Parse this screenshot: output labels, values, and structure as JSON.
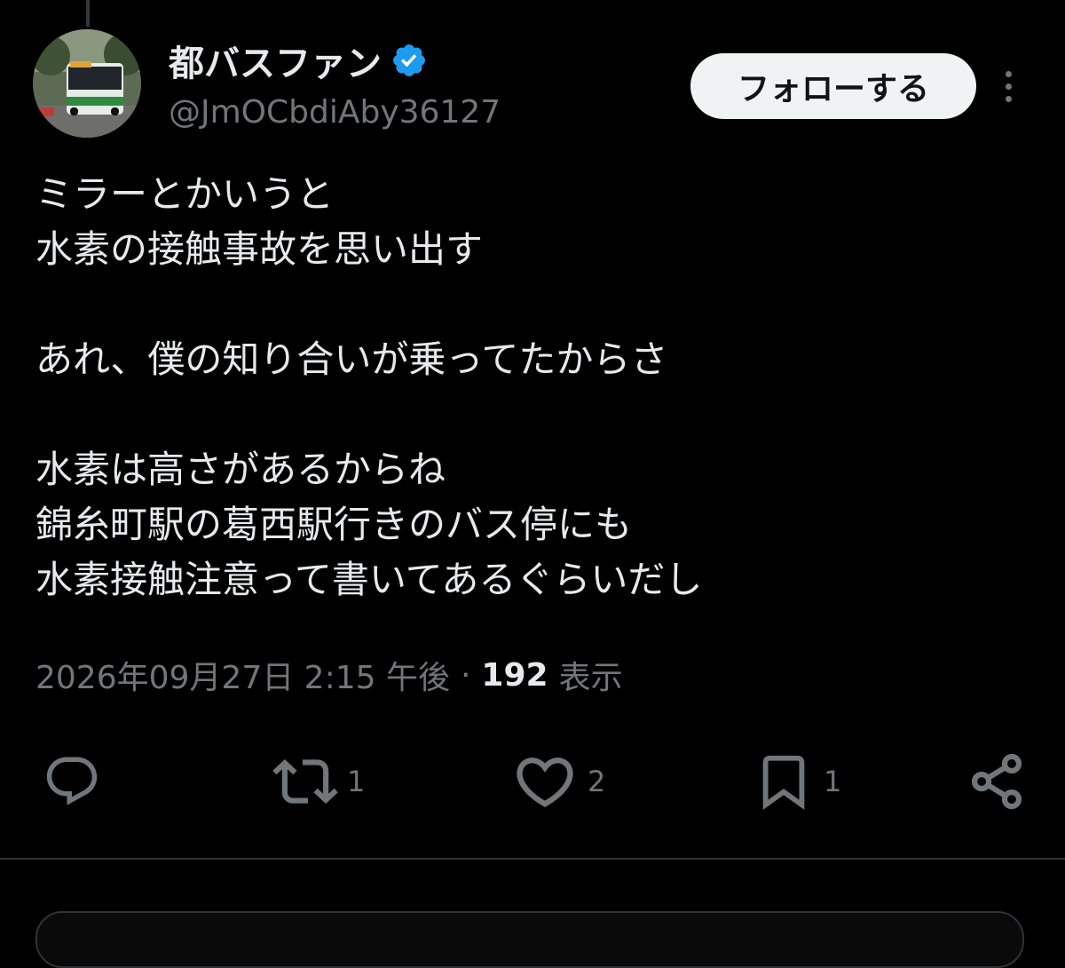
{
  "colors": {
    "background": "#000000",
    "primary_text": "#e7e9ea",
    "secondary_text": "#71767b",
    "verified_blue": "#1d9bf0",
    "follow_button_bg": "#eff3f4",
    "divider": "#2f3336"
  },
  "author": {
    "display_name": "都バスファン",
    "handle": "@JmOCbdiAby36127",
    "verified": true,
    "avatar_icon": "bus-photo-avatar"
  },
  "header": {
    "follow_label": "フォローする",
    "more_icon": "more-vertical-icon"
  },
  "tweet": {
    "lines": [
      "ミラーとかいうと",
      "水素の接触事故を思い出す",
      "",
      "あれ、僕の知り合いが乗ってたからさ",
      "",
      "水素は高さがあるからね",
      "錦糸町駅の葛西駅行きのバス停にも",
      "水素接触注意って書いてあるぐらいだし"
    ]
  },
  "meta": {
    "timestamp": "2026年09月27日 2:15 午後",
    "separator": "·",
    "views_count": "192",
    "views_label": "表示"
  },
  "actions": {
    "reply": {
      "icon": "reply-icon",
      "count": ""
    },
    "repost": {
      "icon": "repost-icon",
      "count": "1"
    },
    "like": {
      "icon": "heart-icon",
      "count": "2"
    },
    "bookmark": {
      "icon": "bookmark-icon",
      "count": "1"
    },
    "share": {
      "icon": "share-icon",
      "count": ""
    }
  }
}
